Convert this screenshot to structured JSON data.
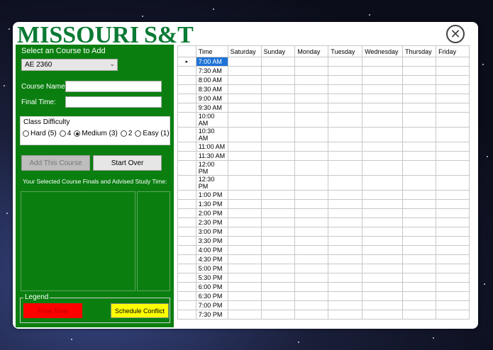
{
  "app": {
    "logo_main": "MISSOURI",
    "logo_suffix": "S&T"
  },
  "panel": {
    "select_label": "Select an Course to Add",
    "course_selected": "AE 2360",
    "course_name_label": "Course Name:",
    "course_name_value": "",
    "final_time_label": "Final Time:",
    "final_time_value": "",
    "difficulty_title": "Class Difficulty",
    "difficulty_options": [
      "Hard (5)",
      "4",
      "Medium (3)",
      "2",
      "Easy (1)"
    ],
    "difficulty_selected": "Medium (3)",
    "add_button": "Add This Course",
    "start_over_button": "Start Over",
    "finals_label": "Your Selected Course Finals and Advised Study Time:",
    "legend_title": "Legend",
    "legend_final": "Final Time",
    "legend_conflict": "Schedule Conflict",
    "colors": {
      "final": "#ff0000",
      "conflict": "#ffff00",
      "panel": "#0a7f10"
    }
  },
  "schedule": {
    "columns": [
      "Time",
      "Saturday",
      "Sunday",
      "Monday",
      "Tuesday",
      "Wednesday",
      "Thursday",
      "Friday"
    ],
    "times": [
      "7:00 AM",
      "7:30 AM",
      "8:00 AM",
      "8:30 AM",
      "9:00 AM",
      "9:30 AM",
      "10:00 AM",
      "10:30 AM",
      "11:00 AM",
      "11:30 AM",
      "12:00 PM",
      "12:30 PM",
      "1:00 PM",
      "1:30 PM",
      "2:00 PM",
      "2:30 PM",
      "3:00 PM",
      "3:30 PM",
      "4:00 PM",
      "4:30 PM",
      "5:00 PM",
      "5:30 PM",
      "6:00 PM",
      "6:30 PM",
      "7:00 PM",
      "7:30 PM"
    ],
    "selected_row": 0
  }
}
